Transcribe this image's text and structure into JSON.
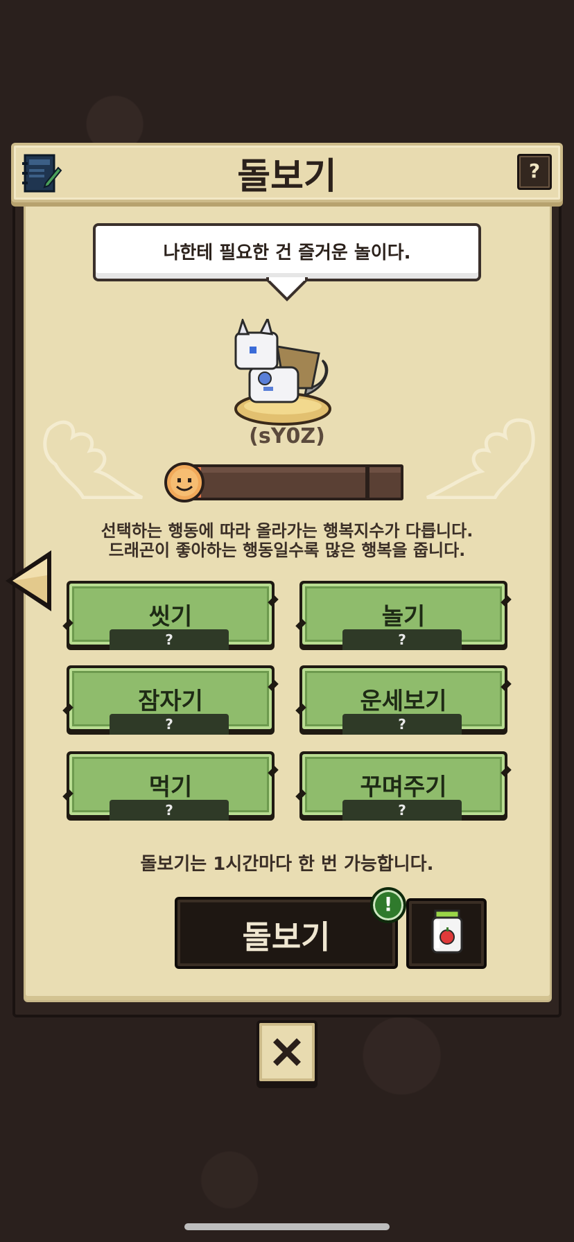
{
  "header": {
    "title": "돌보기",
    "help_label": "?"
  },
  "speech": {
    "text": "나한테 필요한 건 즐거운 놀이다."
  },
  "dragon": {
    "name": "(sY0Z)"
  },
  "happiness": {
    "level_fraction": 0.06
  },
  "info": {
    "line1": "선택하는 행동에 따라 올라가는 행복지수가 다릅니다.",
    "line2": "드래곤이 좋아하는 행동일수록 많은 행복을 줍니다."
  },
  "actions": [
    {
      "label": "씻기",
      "badge": "?"
    },
    {
      "label": "놀기",
      "badge": "?"
    },
    {
      "label": "잠자기",
      "badge": "?"
    },
    {
      "label": "운세보기",
      "badge": "?"
    },
    {
      "label": "먹기",
      "badge": "?"
    },
    {
      "label": "꾸며주기",
      "badge": "?"
    }
  ],
  "note": "돌보기는 1시간마다 한 번 가능합니다.",
  "care_button": {
    "label": "돌보기",
    "alert": "!"
  },
  "colors": {
    "action_green": "#8fbc6c",
    "bar_fill": "#e9784c",
    "paper": "#e9ddb3"
  }
}
